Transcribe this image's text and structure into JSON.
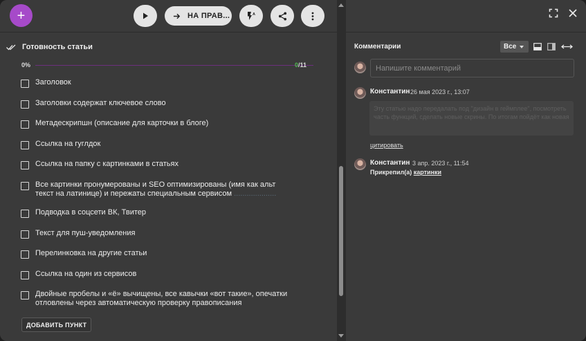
{
  "toolbar": {
    "add_label": "+",
    "status_button_label": "НА ПРАВ...",
    "play_icon": "play-icon",
    "arrow_icon": "arrow-right-icon",
    "flash_icon": "flash-auto-icon",
    "share_icon": "share-icon",
    "more_icon": "more-vertical-icon"
  },
  "checklist": {
    "title": "Готовность статьи",
    "progress_percent": "0%",
    "progress_done": "0",
    "progress_total": "/11",
    "progress_value": 0,
    "items": [
      {
        "label": "Заголовок",
        "faint": ""
      },
      {
        "label": "Заголовки содержат ключевое слово",
        "faint": ""
      },
      {
        "label": "Метадескрипшн (описание для карточки в блоге)",
        "faint": ""
      },
      {
        "label": "Ссылка на гуглдок",
        "faint": ""
      },
      {
        "label": "Ссылка на папку с картинками в статьях",
        "faint": ""
      },
      {
        "label": "Все картинки пронумерованы и SEO оптимизированы (имя как альт текст на латинице) и пережаты специальным сервисом",
        "faint": "...................."
      },
      {
        "label": "Подводка в соцсети ВК, Твитер",
        "faint": ""
      },
      {
        "label": "Текст для пуш-уведомления",
        "faint": ""
      },
      {
        "label": "Перелинковка на другие статьи",
        "faint": ""
      },
      {
        "label": "Ссылка на один из сервисов",
        "faint": ""
      },
      {
        "label": "Двойные пробелы и «ё» вычищены, все кавычки «вот такие», опечатки отловлены через автоматическую проверку правописания",
        "faint": ""
      }
    ],
    "add_button": "ДОБАВИТЬ ПУНКТ"
  },
  "comments": {
    "title": "Комментарии",
    "filter_value": "Все",
    "input_placeholder": "Напишите комментарий",
    "list": [
      {
        "author": "Константин",
        "date": "26 мая 2023 г., 13:07",
        "text": "Эту статью надо передалать под \"дизайн в геймплее\", посмотреть часть функций, сделать новые скрины. По итогам пойдёт как новая",
        "cite_label": "цитировать"
      },
      {
        "author": "Константин",
        "date": "3 апр. 2023 г., 11:54",
        "attached_prefix": "Прикрепил(а)",
        "attached_link": "картинки"
      }
    ]
  },
  "colors": {
    "accent": "#a64ac9",
    "progress_track": "#6c2f7f",
    "progress_count": "#4fb84f",
    "panel_bg": "#3a3a3a"
  }
}
